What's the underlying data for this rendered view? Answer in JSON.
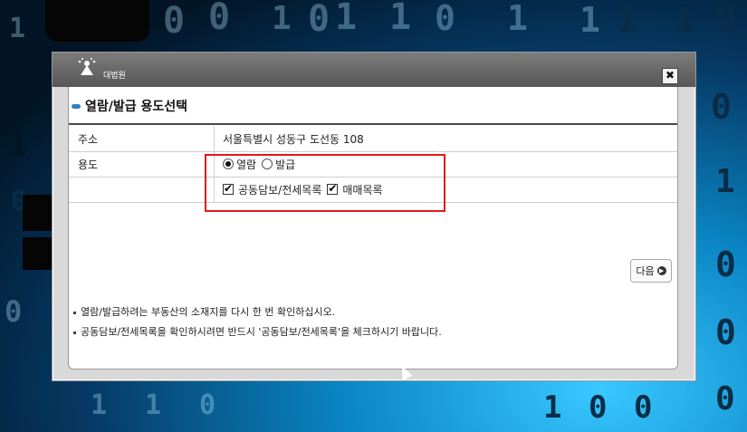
{
  "dialog": {
    "brand": "대법원",
    "close_symbol": "✖",
    "heading": "열람/발급 용도선택",
    "rows": {
      "address_label": "주소",
      "address_value": "서울특별시 성동구 도선동 108",
      "purpose_label": "용도",
      "radio_view": "열람",
      "radio_issue": "발급",
      "check_joint": "공동담보/전세목록",
      "check_sale": "매매목록"
    },
    "state": {
      "radio_selected": "열람",
      "check_joint_checked": true,
      "check_sale_checked": true
    },
    "next_button": "다음",
    "notes": [
      "열람/발급하려는 부동산의 소재지를 다시 한 번 확인하십시오.",
      "공동담보/전세목록을 확인하시려면 반드시 '공동담보/전세목록'을 체크하시기 바랍니다."
    ]
  },
  "colors": {
    "highlight_box": "#e0191d",
    "heading_mark": "#2f80c8"
  }
}
